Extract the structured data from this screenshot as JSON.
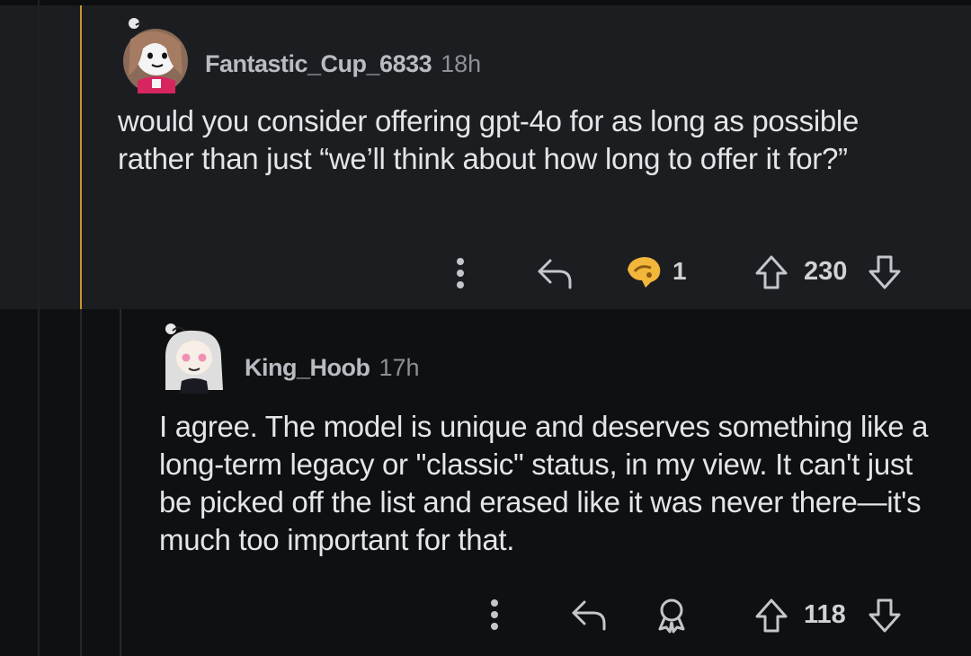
{
  "comments": [
    {
      "username": "Fantastic_Cup_6833",
      "age": "18h",
      "text": "would you consider offering gpt-4o for as long as possible rather than just “we’ll think about how long to offer it for?”",
      "award_count": "1",
      "score": "230",
      "icons": [
        "more-icon",
        "reply-icon",
        "award-icon",
        "upvote-icon",
        "downvote-icon"
      ],
      "thread_color": "#c6952a"
    },
    {
      "username": "King_Hoob",
      "age": "17h",
      "text": "I agree. The model is unique and deserves something like a long-term legacy or \"classic\" status, in my view. It can't just be picked off the list and erased like it was never there—it's much too important for that.",
      "score": "118",
      "icons": [
        "more-icon",
        "reply-icon",
        "award-icon",
        "upvote-icon",
        "downvote-icon"
      ]
    }
  ]
}
